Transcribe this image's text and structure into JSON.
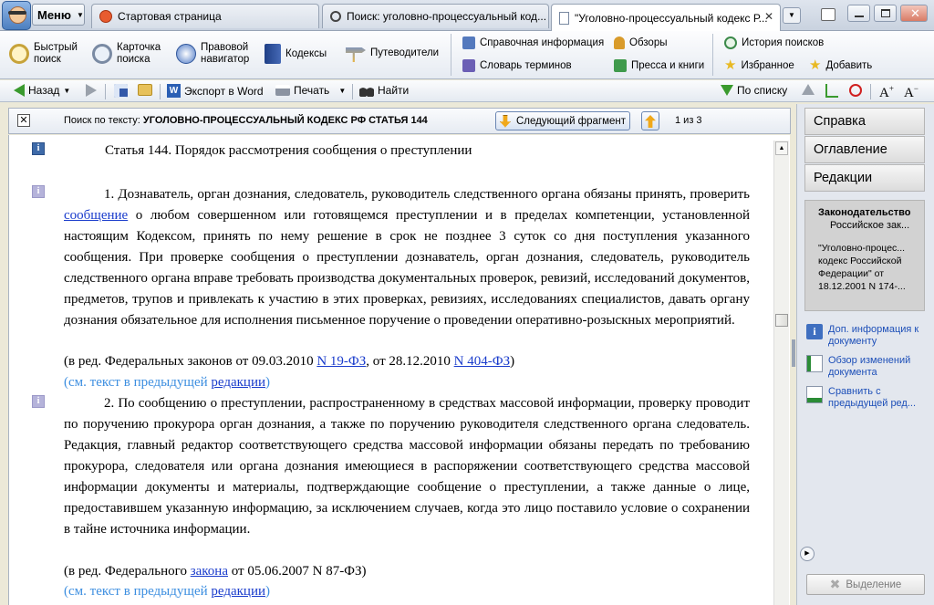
{
  "titlebar": {
    "menu_label": "Меню",
    "tabs": [
      {
        "label": "Стартовая страница"
      },
      {
        "label": "Поиск: уголовно-процессуальный код..."
      },
      {
        "label": "\"Уголовно-процессуальный кодекс Р..."
      }
    ]
  },
  "ribbon": {
    "quick_search": "Быстрый\nпоиск",
    "card_search": "Карточка\nпоиска",
    "legal_navigator": "Правовой\nнавигатор",
    "codes": "Кодексы",
    "guides": "Путеводители",
    "reference_info": "Справочная информация",
    "glossary": "Словарь терминов",
    "reviews": "Обзоры",
    "press": "Пресса и книги",
    "search_history": "История поисков",
    "favorites": "Избранное",
    "add": "Добавить"
  },
  "toolbar": {
    "back": "Назад",
    "export_word": "Экспорт в Word",
    "print": "Печать",
    "find": "Найти",
    "by_list": "По списку"
  },
  "searchbar": {
    "prefix": "Поиск по тексту:",
    "query": "УГОЛОВНО-ПРОЦЕССУАЛЬНЫЙ КОДЕКС РФ СТАТЬЯ 144",
    "next_fragment": "Следующий фрагмент",
    "counter": "1 из 3"
  },
  "document": {
    "title": "Статья 144. Порядок рассмотрения сообщения о преступлении",
    "p1_a": "1. Дознаватель, орган дознания, следователь, руководитель следственного органа обязаны принять, проверить ",
    "p1_link": "сообщение",
    "p1_b": " о любом совершенном или готовящемся преступлении и в пределах компетенции, установленной настоящим Кодексом, принять по нему решение в срок не позднее 3 суток со дня поступления указанного сообщения. При проверке сообщения о преступлении дознаватель, орган дознания, следователь, руководитель следственного органа вправе требовать производства документальных проверок, ревизий, исследований документов, предметов, трупов и привлекать к участию в этих проверках, ревизиях, исследованиях специалистов, давать органу дознания обязательное для исполнения письменное поручение о проведении оперативно-розыскных мероприятий.",
    "amend1_a": "(в ред. Федеральных законов от 09.03.2010 ",
    "amend1_link1": "N 19-ФЗ",
    "amend1_b": ", от 28.12.2010 ",
    "amend1_link2": "N 404-ФЗ",
    "amend1_c": ")",
    "prev_a": "(см. текст в предыдущей ",
    "prev_link": "редакции",
    "prev_c": ")",
    "p2": "2. По сообщению о преступлении, распространенному в средствах массовой информации, проверку проводит по поручению прокурора орган дознания, а также по поручению руководителя следственного органа следователь. Редакция, главный редактор соответствующего средства массовой информации обязаны передать по требованию прокурора, следователя или органа дознания имеющиеся в распоряжении соответствующего средства массовой информации документы и материалы, подтверждающие сообщение о преступлении, а также данные о лице, предоставившем указанную информацию, за исключением случаев, когда это лицо поставило условие о сохранении в тайне источника информации.",
    "amend2_a": "(в ред. Федерального ",
    "amend2_link": "закона",
    "amend2_b": " от 05.06.2007 N 87-ФЗ)"
  },
  "rpanel": {
    "tab_help": "Справка",
    "tab_toc": "Оглавление",
    "tab_editions": "Редакции",
    "box_title": "Законодательство",
    "box_sub": "Российское зак...",
    "box_doc": "\"Уголовно-процес... кодекс Российской Федерации\" от 18.12.2001 N 174-...",
    "link_info": "Доп. информация к документу",
    "link_changes": "Обзор изменений документа",
    "link_compare": "Сравнить с предыдущей ред...",
    "selection": "Выделение"
  }
}
